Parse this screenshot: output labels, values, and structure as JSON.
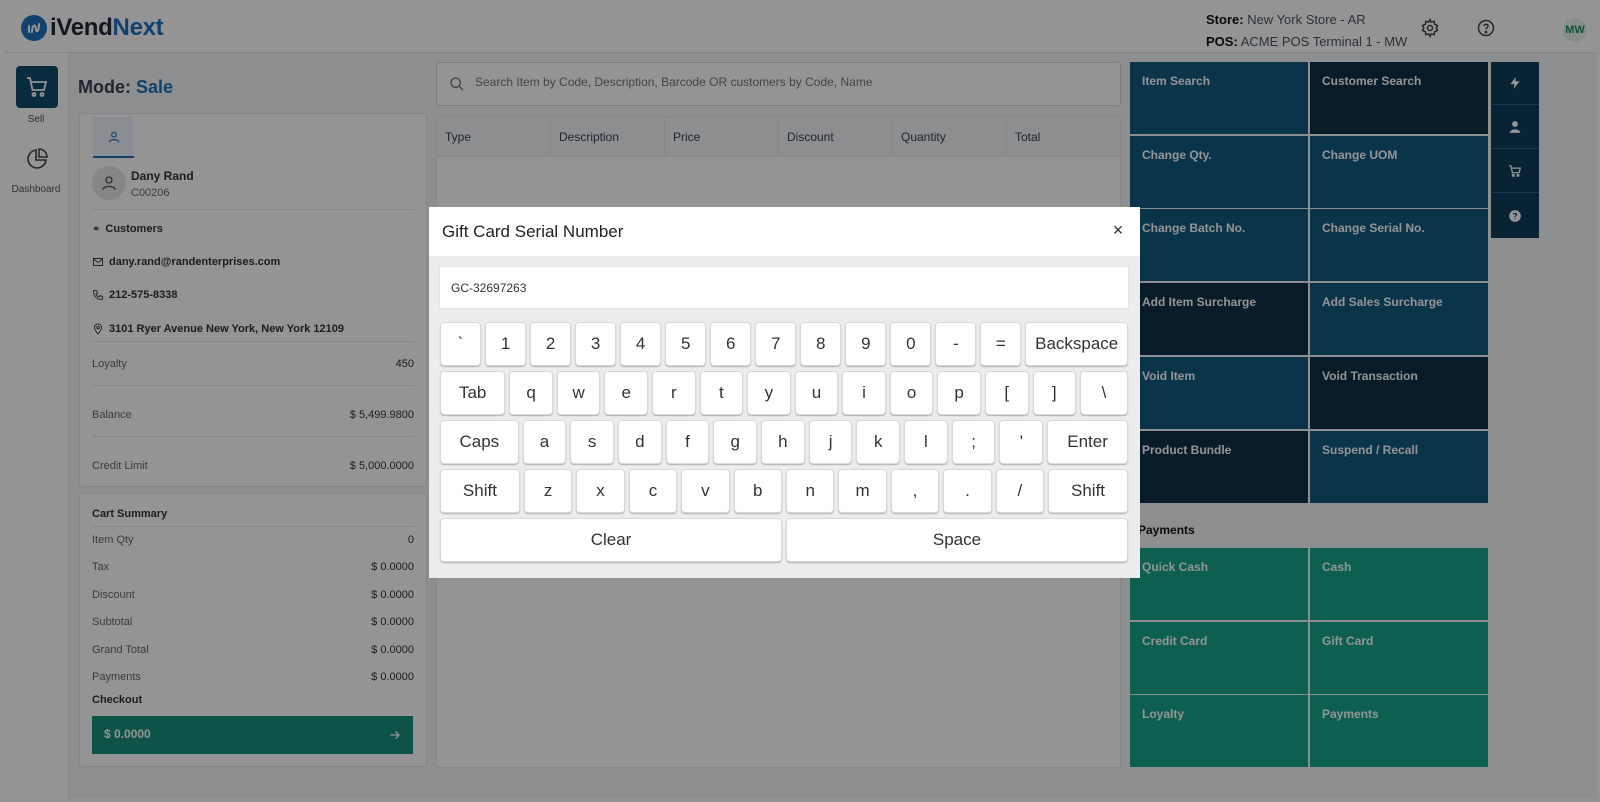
{
  "header": {
    "logo_prefix": "iVend",
    "logo_accent": "Next",
    "store_label": "Store:",
    "store_value": "New York Store - AR",
    "pos_label": "POS:",
    "pos_value": "ACME POS Terminal 1 - MW",
    "user_initials": "MW",
    "icons": [
      "settings-gear-icon",
      "help-circle-icon"
    ]
  },
  "leftnav": {
    "items": [
      {
        "label": "Sell",
        "icon": "cart-icon"
      },
      {
        "label": "Dashboard",
        "icon": "pie-chart-icon"
      }
    ]
  },
  "mode": {
    "label": "Mode:",
    "value": "Sale"
  },
  "customer": {
    "name": "Dany Rand",
    "code": "C00206",
    "group": "Customers",
    "email": "dany.rand@randenterprises.com",
    "phone": "212-575-8338",
    "address": "3101 Ryer Avenue New York, New York 12109",
    "loyalty_label": "Loyalty",
    "loyalty_value": "450",
    "balance_label": "Balance",
    "balance_value": "$ 5,499.9800",
    "credit_label": "Credit Limit",
    "credit_value": "$ 5,000.0000"
  },
  "cart_summary": {
    "title": "Cart Summary",
    "rows": [
      {
        "label": "Item Qty",
        "value": "0"
      },
      {
        "label": "Tax",
        "value": "$ 0.0000"
      },
      {
        "label": "Discount",
        "value": "$ 0.0000"
      },
      {
        "label": "Subtotal",
        "value": "$ 0.0000"
      },
      {
        "label": "Grand Total",
        "value": "$ 0.0000"
      },
      {
        "label": "Payments",
        "value": "$ 0.0000"
      }
    ],
    "checkout_label": "Checkout",
    "checkout_amount": "$ 0.0000"
  },
  "search": {
    "placeholder": "Search Item by Code, Description, Barcode OR customers by Code, Name"
  },
  "grid": {
    "columns": [
      "Type",
      "Description",
      "Price",
      "Discount",
      "Quantity",
      "Total"
    ]
  },
  "functions": [
    {
      "label": "Item Search",
      "style": "blue"
    },
    {
      "label": "Customer Search",
      "style": "dark"
    },
    {
      "label": "Change Qty.",
      "style": "blue"
    },
    {
      "label": "Change UOM",
      "style": "blue"
    },
    {
      "label": "Change Batch No.",
      "style": "blue"
    },
    {
      "label": "Change Serial No.",
      "style": "blue"
    },
    {
      "label": "Add Item Surcharge",
      "style": "dark"
    },
    {
      "label": "Add Sales Surcharge",
      "style": "blue"
    },
    {
      "label": "Void Item",
      "style": "blue"
    },
    {
      "label": "Void Transaction",
      "style": "dark"
    },
    {
      "label": "Product Bundle",
      "style": "dark"
    },
    {
      "label": "Suspend / Recall",
      "style": "blue"
    }
  ],
  "payments": {
    "title": "Payments",
    "items": [
      "Quick Cash",
      "Cash",
      "Credit Card",
      "Gift Card",
      "Loyalty",
      "Payments"
    ]
  },
  "rail": {
    "icons": [
      "lightning-icon",
      "user-icon",
      "cart-icon",
      "help-icon"
    ]
  },
  "colors": {
    "primary_dark": "#0f4c6b",
    "tile_blue": "#125a80",
    "tile_dark": "#0d2f45",
    "pay_green": "#17a58a",
    "brand_blue": "#1e73be"
  },
  "modal": {
    "title": "Gift Card Serial Number",
    "close": "×",
    "serial_value": "GC-32697263",
    "keyboard": [
      [
        "`",
        "1",
        "2",
        "3",
        "4",
        "5",
        "6",
        "7",
        "8",
        "9",
        "0",
        "-",
        "=",
        "Backspace"
      ],
      [
        "Tab",
        "q",
        "w",
        "e",
        "r",
        "t",
        "y",
        "u",
        "i",
        "o",
        "p",
        "[",
        "]",
        "\\"
      ],
      [
        "Caps",
        "a",
        "s",
        "d",
        "f",
        "g",
        "h",
        "j",
        "k",
        "l",
        ";",
        "'",
        "Enter"
      ],
      [
        "Shift",
        "z",
        "x",
        "c",
        "v",
        "b",
        "n",
        "m",
        ",",
        ".",
        "/",
        "Shift"
      ],
      [
        "Clear",
        "Space"
      ]
    ]
  }
}
